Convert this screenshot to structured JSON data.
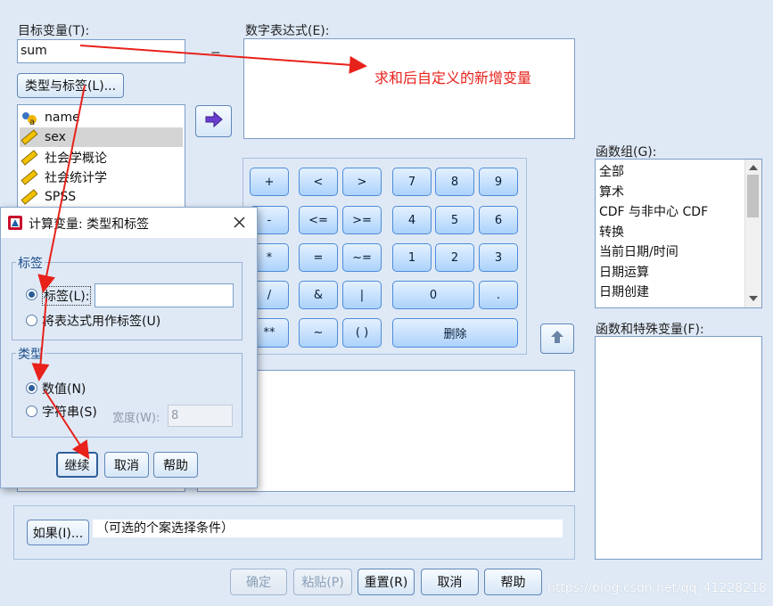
{
  "target_label": "目标变量(T):",
  "target_value": "sum",
  "equals": "=",
  "expr_label": "数字表达式(E):",
  "annotation_text": "求和后自定义的新增变量",
  "type_label_button": "类型与标签(L)...",
  "variables": [
    {
      "name": "name",
      "icon": "nominal-string-icon"
    },
    {
      "name": "sex",
      "icon": "scale-ruler-icon",
      "selected": true
    },
    {
      "name": "社会学概论",
      "icon": "scale-ruler-icon"
    },
    {
      "name": "社会统计学",
      "icon": "scale-ruler-icon"
    },
    {
      "name": "SPSS",
      "icon": "scale-ruler-icon"
    }
  ],
  "move_arrow_icon": "right-arrow-icon",
  "keypad": {
    "plus": "+",
    "lt": "<",
    "gt": ">",
    "k7": "7",
    "k8": "8",
    "k9": "9",
    "minus": "-",
    "le": "<=",
    "ge": ">=",
    "k4": "4",
    "k5": "5",
    "k6": "6",
    "mul": "*",
    "eq": "=",
    "ne": "~=",
    "k1": "1",
    "k2": "2",
    "k3": "3",
    "div": "/",
    "and": "&",
    "or": "|",
    "k0": "0",
    "dot": ".",
    "pow": "**",
    "not": "~",
    "paren": "( )",
    "delete": "删除"
  },
  "func_group_label": "函数组(G):",
  "func_groups": [
    "全部",
    "算术",
    "CDF 与非中心 CDF",
    "转换",
    "当前日期/时间",
    "日期运算",
    "日期创建"
  ],
  "func_vars_label": "函数和特殊变量(F):",
  "if_button": "如果(I)...",
  "if_text": "（可选的个案选择条件）",
  "bottom_buttons": {
    "ok": "确定",
    "paste": "粘贴(P)",
    "reset": "重置(R)",
    "cancel": "取消",
    "help": "帮助"
  },
  "watermark": "https://blog.csdn.net/qq_41228218",
  "dialog": {
    "title": "计算变量: 类型和标签",
    "label_group": "标签",
    "label_radio": "标签(L):",
    "label_value": "",
    "expr_radio": "将表达式用作标签(U)",
    "type_group": "类型",
    "numeric_radio": "数值(N)",
    "string_radio": "字符串(S)",
    "width_label": "宽度(W):",
    "width_value": "8",
    "continue": "继续",
    "cancel": "取消",
    "help": "帮助"
  },
  "colors": {
    "annotation": "#e8211b",
    "accent": "#2a5d9a",
    "keypad": "#acd2fb"
  }
}
